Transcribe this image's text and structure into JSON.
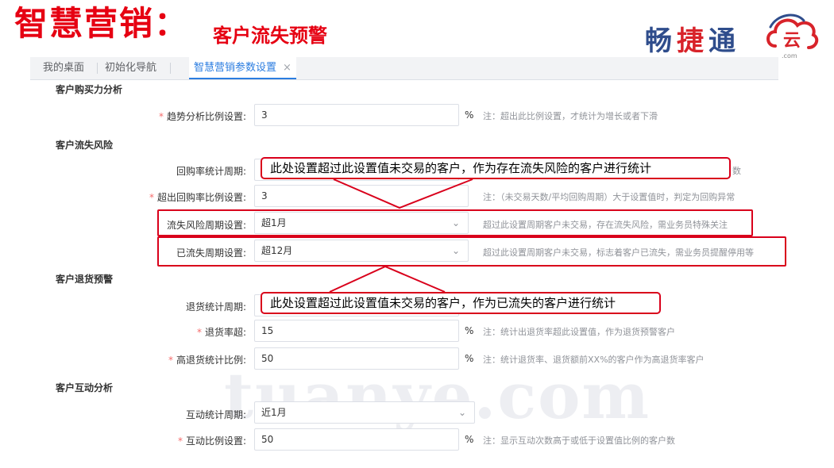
{
  "slide": {
    "title": "智慧营销：",
    "subtitle": "客户流失预警"
  },
  "logo": {
    "text_1": "畅",
    "text_2": "捷",
    "text_3": "通",
    "mark_glyph": "云",
    "domain": ".com",
    "colors": {
      "blue": "#2f4d8c",
      "red": "#d8232a"
    }
  },
  "tabs": [
    {
      "label": "我的桌面"
    },
    {
      "label": "初始化导航"
    },
    {
      "label": "智慧营销参数设置",
      "close": "×"
    }
  ],
  "sections": {
    "purchase": "客户购买力分析",
    "churn_risk": "客户流失风险",
    "returns": "客户退货预警",
    "interaction": "客户互动分析"
  },
  "fields": {
    "trend_ratio": {
      "label": "趋势分析比例设置:",
      "required": "*",
      "value": "3",
      "unit": "%",
      "note": "注：超出此比例设置，才统计为增长或者下滑"
    },
    "repurchase_period": {
      "label": "回购率统计周期:",
      "note_tail": "数"
    },
    "over_repurchase_ratio": {
      "label": "超出回购率比例设置:",
      "required": "*",
      "value": "3",
      "note": "注：（未交易天数/平均回购周期）大于设置值时，判定为回购异常"
    },
    "churn_risk_period": {
      "label": "流失风险周期设置:",
      "value": "超1月",
      "note": "超过此设置周期客户未交易，存在流失风险，需业务员特殊关注"
    },
    "churned_period": {
      "label": "已流失周期设置:",
      "value": "超12月",
      "note": "超过此设置周期客户未交易，标志着客户已流失，需业务员提醒停用等"
    },
    "return_period": {
      "label": "退货统计周期:"
    },
    "return_rate": {
      "label": "退货率超:",
      "required": "*",
      "value": "15",
      "unit": "%",
      "note": "注：统计出退货率超此设置值，作为退货预警客户"
    },
    "high_return_ratio": {
      "label": "高退货统计比例:",
      "required": "*",
      "value": "50",
      "unit": "%",
      "note": "注：统计退货率、退货额前XX%的客户作为高退货率客户"
    },
    "interaction_period": {
      "label": "互动统计周期:",
      "value": "近1月"
    },
    "interaction_ratio": {
      "label": "互动比例设置:",
      "required": "*",
      "value": "50",
      "unit": "%",
      "note": "注：显示互动次数高于或低于设置值比例的客户数"
    }
  },
  "callouts": {
    "risk": "此处设置超过此设置值未交易的客户，作为存在流失风险的客户进行统计",
    "churned": "此处设置超过此设置值未交易的客户，作为已流失的客户进行统计"
  },
  "icons": {
    "chevron": "chevron-down-icon",
    "close": "close-icon"
  },
  "accent_colors": {
    "highlight_red": "#d9001b",
    "tab_blue": "#2b7de0",
    "title_red": "#e60012"
  },
  "watermark": "tuanye.com"
}
